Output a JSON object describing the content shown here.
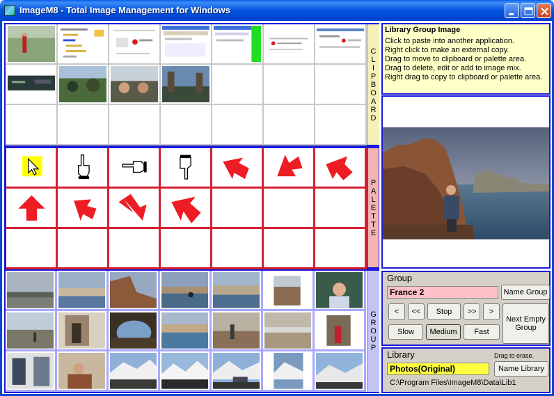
{
  "window": {
    "title": "ImageM8 - Total Image Management for Windows"
  },
  "panels": {
    "clipboard_label": [
      "C",
      "L",
      "I",
      "P",
      "B",
      "O",
      "A",
      "R",
      "D"
    ],
    "palette_label": [
      "P",
      "A",
      "L",
      "E",
      "T",
      "T",
      "E"
    ],
    "group_label": [
      "G",
      "R",
      "O",
      "U",
      "P"
    ]
  },
  "info": {
    "title": "Library Group Image",
    "lines": [
      "Click to paste into another application.",
      "Right click to make an external copy.",
      "Drag to move to clipboard or palette area.",
      "Drag to delete, edit or add to image mix.",
      "Right drag to copy to clipboard or palette area."
    ]
  },
  "group": {
    "heading": "Group",
    "name": "France 2",
    "name_group_button": "Name Group",
    "prev_button": "<",
    "rewind_button": "<<",
    "stop_button": "Stop",
    "fast_forward_button": ">>",
    "next_button": ">",
    "next_empty_group_button": "Next Empty Group",
    "slow_button": "Slow",
    "medium_button": "Medium",
    "fast_button": "Fast"
  },
  "library": {
    "heading": "Library",
    "drag_hint": "Drag to erase.",
    "name": "Photos(Original)",
    "name_library_button": "Name Library",
    "path": "C:\\Program Files\\ImageM8\\Data\\Lib1"
  },
  "colors": {
    "frame_blue": "#0847d2",
    "panel_border": "#1a1ad8",
    "palette_red": "#d42030",
    "arrow_red": "#ee1c24",
    "cursor_highlight": "#ffff00",
    "info_background": "#ffffc8",
    "group_name_field": "#ffc0c8",
    "library_name_field": "#ffff40"
  },
  "palette_items": [
    "pointer-arrow-icon",
    "pointing-hand-up-icon",
    "pointing-hand-left-icon",
    "pointing-hand-down-icon",
    "red-arrow-down-left-icon",
    "red-arrow-up-left-icon",
    "red-arrow-up-left-icon",
    "red-arrow-up-icon",
    "red-arrow-down-left-icon",
    "red-arrow-down-right-icon",
    "red-arrow-up-left-icon"
  ]
}
